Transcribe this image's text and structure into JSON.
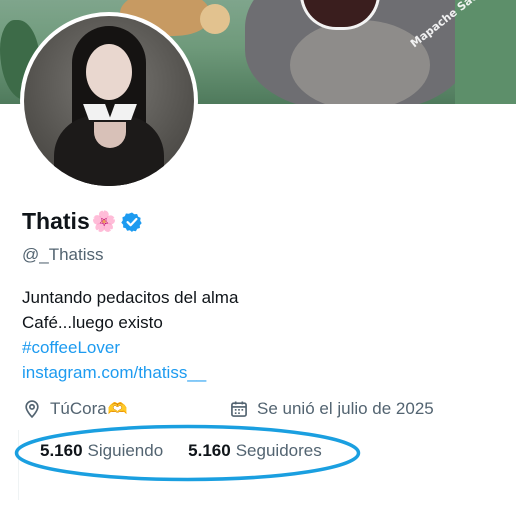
{
  "banner": {
    "watermark": "Mapache Sad"
  },
  "profile": {
    "name": "Thatis",
    "name_emoji": "🌸",
    "handle": "@_Thatiss",
    "bio_lines": [
      "Juntando pedacitos del alma",
      "Café...luego existo"
    ],
    "hashtag": "#coffeeLover",
    "website": "instagram.com/thatiss__",
    "location": "TúCora",
    "location_emoji": "🫶",
    "joined": "Se unió el julio de 2025"
  },
  "stats": {
    "following_count": "5.160",
    "following_label": "Siguiendo",
    "followers_count": "5.160",
    "followers_label": "Seguidores"
  },
  "colors": {
    "link": "#1d9bf0",
    "verified": "#1d9bf0",
    "secondary_text": "#536471",
    "annotation_ellipse": "#1a9fe0"
  },
  "icons": [
    "verified-badge-icon",
    "location-pin-icon",
    "calendar-icon",
    "flower-icon",
    "heart-hands-icon"
  ]
}
